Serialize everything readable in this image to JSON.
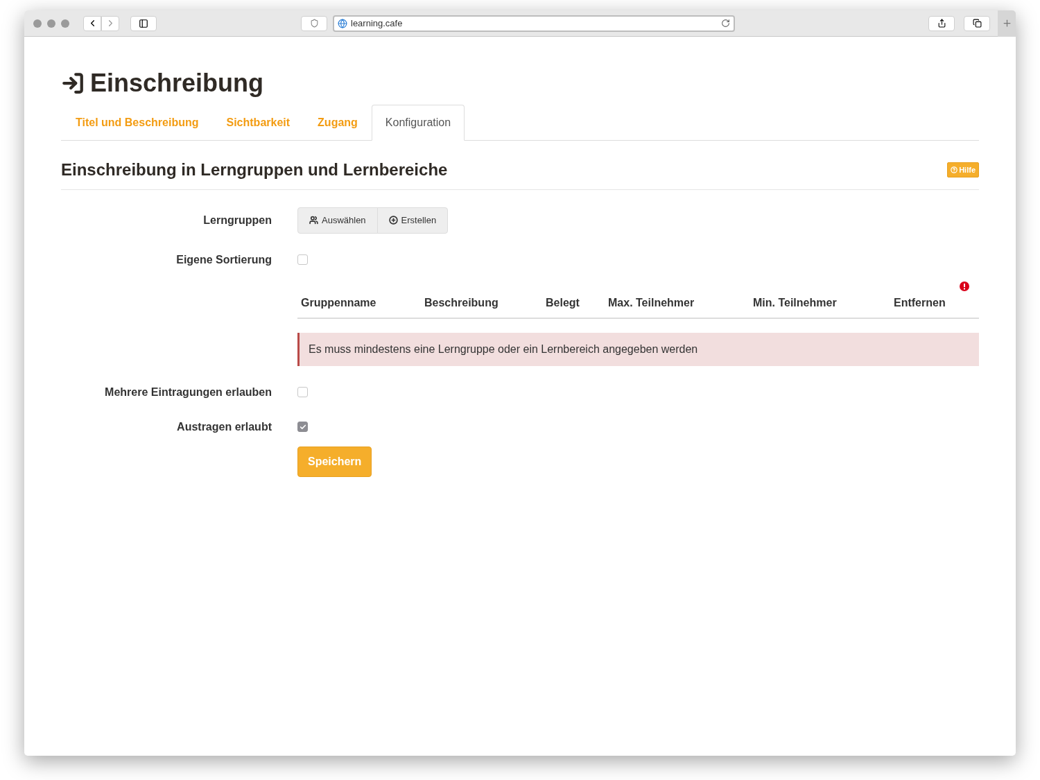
{
  "browser": {
    "url": "learning.cafe"
  },
  "page": {
    "title": "Einschreibung"
  },
  "tabs": [
    {
      "label": "Titel und Beschreibung",
      "selected": false
    },
    {
      "label": "Sichtbarkeit",
      "selected": false
    },
    {
      "label": "Zugang",
      "selected": false
    },
    {
      "label": "Konfiguration",
      "selected": true
    }
  ],
  "section": {
    "title": "Einschreibung in Lerngruppen und Lernbereiche",
    "help": "Hilfe"
  },
  "form": [
    {
      "kind": "buttons",
      "label": "Lerngruppen",
      "buttons": [
        {
          "kind": "users",
          "label": "Auswählen"
        },
        {
          "kind": "add",
          "label": "Erstellen"
        }
      ]
    },
    {
      "kind": "checkbox",
      "label": "Eigene Sortierung",
      "checked": false
    },
    {
      "kind": "table",
      "invalid": true,
      "columns": [
        "Gruppenname",
        "Beschreibung",
        "Belegt",
        "Max. Teilnehmer",
        "Min. Teilnehmer",
        "Entfernen"
      ],
      "message": "Es muss mindestens eine Lerngruppe oder ein Lernbereich angegeben werden"
    },
    {
      "kind": "checkbox",
      "label": "Mehrere Eintragungen erlauben",
      "checked": false
    },
    {
      "kind": "checkbox",
      "label": "Austragen erlaubt",
      "checked": true
    }
  ],
  "save_button": "Speichern"
}
